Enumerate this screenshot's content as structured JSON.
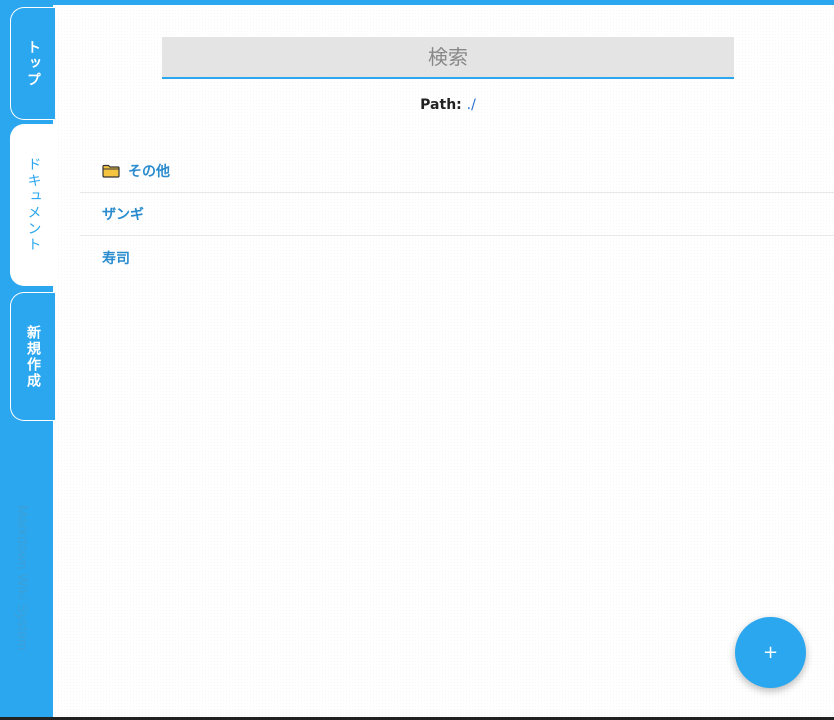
{
  "sidebar": {
    "tabs": [
      {
        "label": "トップ"
      },
      {
        "label": "ドキュメント"
      },
      {
        "label": "新規作成"
      }
    ],
    "app_title": "Markdown Wiki System"
  },
  "search": {
    "placeholder": "検索",
    "value": ""
  },
  "path": {
    "label": "Path:",
    "value": "./"
  },
  "list": {
    "items": [
      {
        "label": "その他",
        "icon": "folder-icon"
      },
      {
        "label": "ザンギ"
      },
      {
        "label": "寿司"
      }
    ]
  },
  "fab": {
    "label": "+"
  },
  "colors": {
    "accent": "#2aa7ee",
    "link": "#2a8cce",
    "folder": "#f5c542"
  }
}
